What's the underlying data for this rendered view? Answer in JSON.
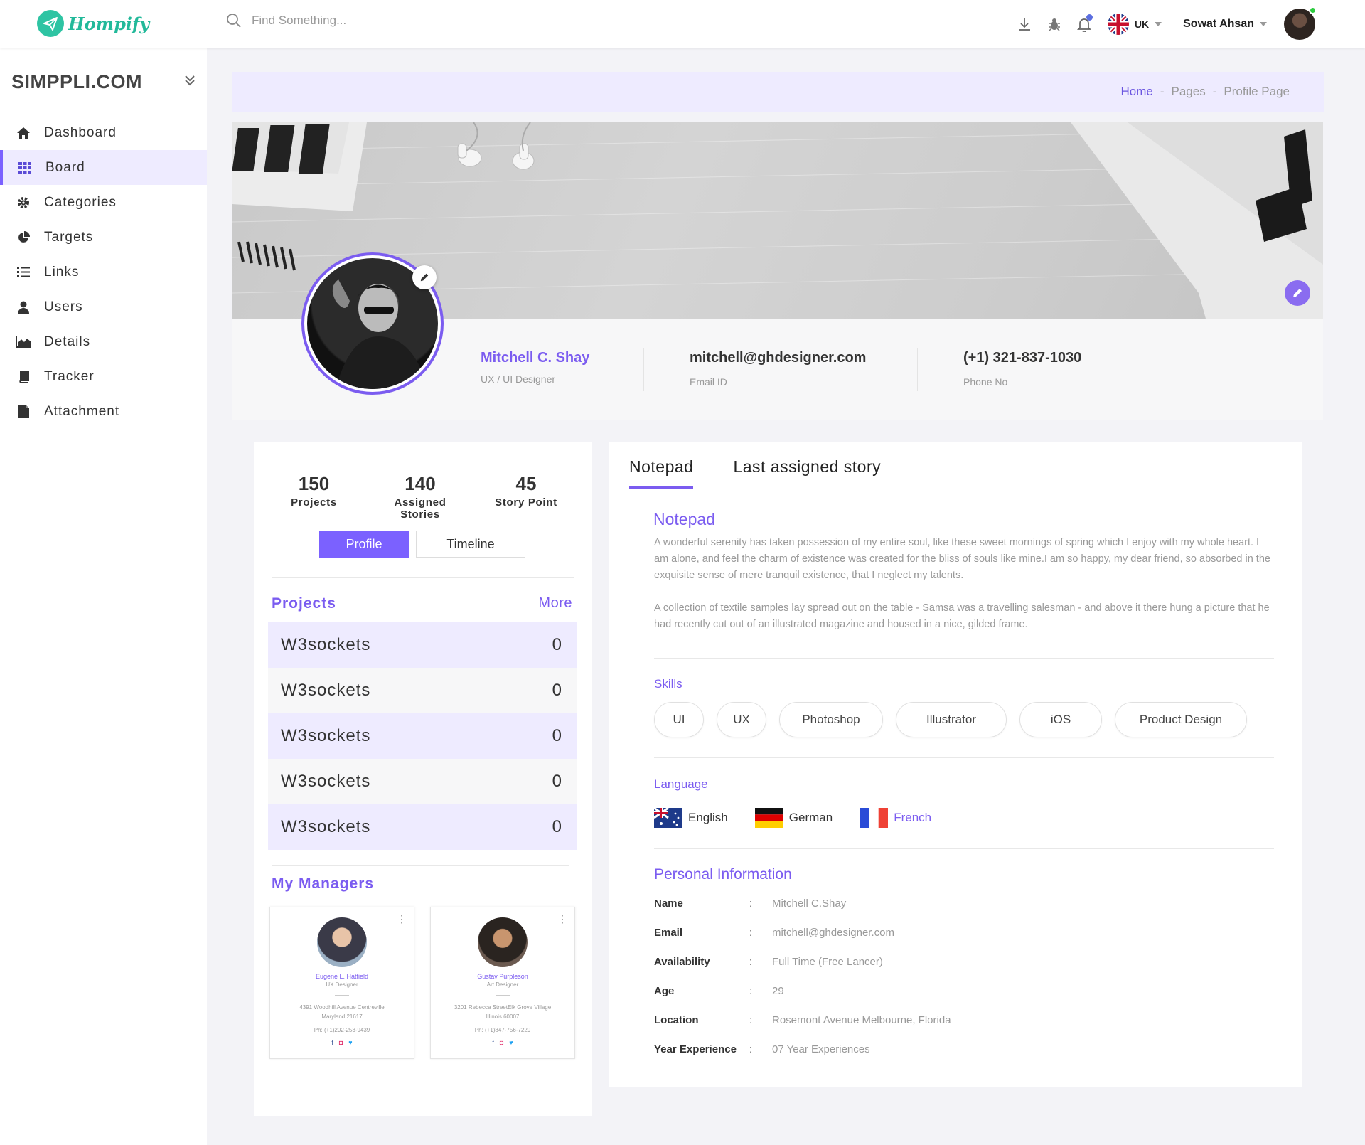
{
  "header": {
    "brand": "Hompify",
    "search_placeholder": "Find Something...",
    "language": "UK",
    "user_name": "Sowat Ahsan"
  },
  "sidebar": {
    "title": "SIMPPLI.COM",
    "items": [
      {
        "label": "Dashboard",
        "icon": "home-icon"
      },
      {
        "label": "Board",
        "icon": "grid-icon",
        "active": true
      },
      {
        "label": "Categories",
        "icon": "gear-icon"
      },
      {
        "label": "Targets",
        "icon": "pie-chart-icon"
      },
      {
        "label": "Links",
        "icon": "list-icon"
      },
      {
        "label": "Users",
        "icon": "user-icon"
      },
      {
        "label": "Details",
        "icon": "area-chart-icon"
      },
      {
        "label": "Tracker",
        "icon": "book-icon"
      },
      {
        "label": "Attachment",
        "icon": "file-icon"
      }
    ]
  },
  "breadcrumb": {
    "home": "Home",
    "sep": "-",
    "pages": "Pages",
    "current": "Profile Page"
  },
  "profile": {
    "name": "Mitchell C. Shay",
    "role": "UX / UI Designer",
    "email": "mitchell@ghdesigner.com",
    "email_label": "Email ID",
    "phone": "(+1) 321-837-1030",
    "phone_label": "Phone No"
  },
  "stats": [
    {
      "value": "150",
      "label": "Projects"
    },
    {
      "value": "140",
      "label": "Assigned Stories"
    },
    {
      "value": "45",
      "label": "Story Point"
    }
  ],
  "left_tabs": {
    "profile": "Profile",
    "timeline": "Timeline"
  },
  "projects": {
    "title": "Projects",
    "more": "More",
    "rows": [
      {
        "name": "W3sockets",
        "count": "0"
      },
      {
        "name": "W3sockets",
        "count": "0"
      },
      {
        "name": "W3sockets",
        "count": "0"
      },
      {
        "name": "W3sockets",
        "count": "0"
      },
      {
        "name": "W3sockets",
        "count": "0"
      }
    ]
  },
  "managers": {
    "title": "My Managers",
    "list": [
      {
        "name": "Eugene L. Hatfield",
        "role": "UX Designer",
        "addr1": "4391 Woodhill Avenue Centreville",
        "addr2": "Maryland 21617",
        "phone": "Ph: (+1)202-253-9439"
      },
      {
        "name": "Gustav Purpleson",
        "role": "Art Designer",
        "addr1": "3201 Rebecca StreetElk Grove Village",
        "addr2": "Illinois 60007",
        "phone": "Ph: (+1)847-756-7229"
      }
    ]
  },
  "right_tabs": [
    "Notepad",
    "Last assigned story"
  ],
  "notepad": {
    "title": "Notepad",
    "p1": "A wonderful serenity has taken possession of my entire soul, like these sweet mornings of spring which I enjoy with my whole heart. I am alone, and feel the charm of existence was created for the bliss of souls like mine.I am so happy, my dear friend, so absorbed in the exquisite sense of mere tranquil existence, that I neglect my talents.",
    "p2": "A collection of textile samples lay spread out on the table - Samsa was a travelling salesman - and above it there hung a picture that he had recently cut out of an illustrated magazine and housed in a nice, gilded frame."
  },
  "skills": {
    "title": "Skills",
    "items": [
      "UI",
      "UX",
      "Photoshop",
      "Illustrator",
      "iOS",
      "Product Design"
    ]
  },
  "language": {
    "title": "Language",
    "items": [
      "English",
      "German",
      "French"
    ],
    "selected": "French"
  },
  "personal": {
    "title": "Personal Information",
    "rows": [
      {
        "k": "Name",
        "v": "Mitchell C.Shay"
      },
      {
        "k": "Email",
        "v": "mitchell@ghdesigner.com"
      },
      {
        "k": "Availability",
        "v": "Full Time (Free Lancer)"
      },
      {
        "k": "Age",
        "v": "29"
      },
      {
        "k": "Location",
        "v": "Rosemont Avenue Melbourne, Florida"
      },
      {
        "k": "Year Experience",
        "v": "07 Year Experiences"
      }
    ]
  },
  "colors": {
    "accent": "#7b5cf0",
    "brand": "#22b99a",
    "highlight": "#eeebff"
  }
}
